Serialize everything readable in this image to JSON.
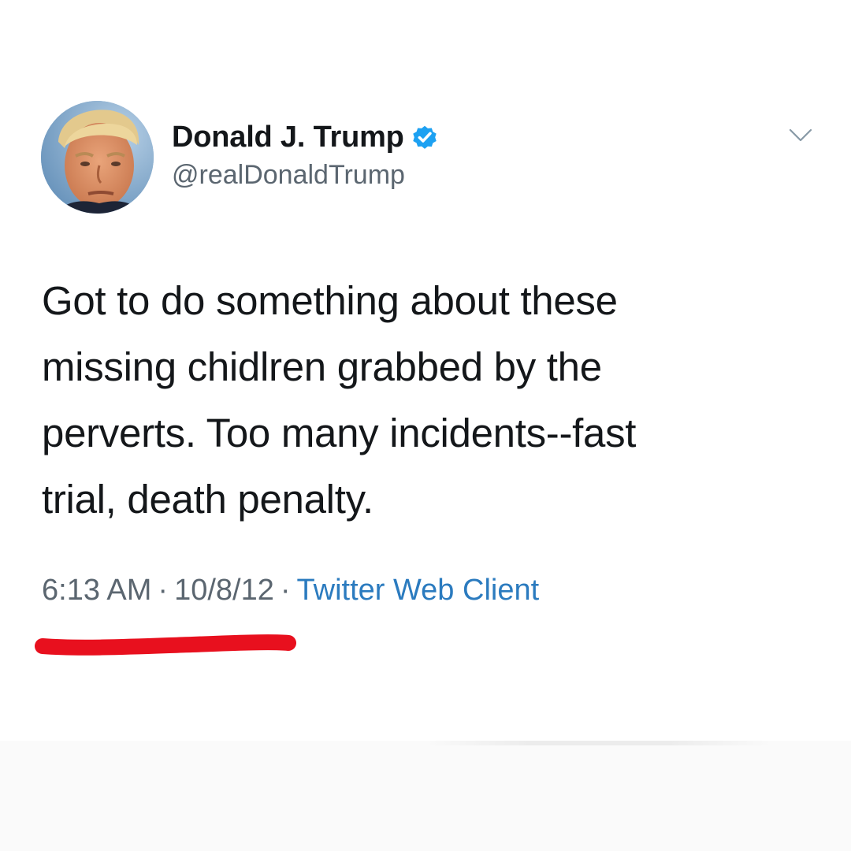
{
  "tweet": {
    "display_name": "Donald J. Trump",
    "handle": "@realDonaldTrump",
    "verified": true,
    "text_lines": [
      "Got to do something about these",
      "missing chidlren grabbed by the",
      "perverts. Too many incidents--fast",
      "trial, death penalty."
    ],
    "time": "6:13 AM",
    "separator": "·",
    "date": "10/8/12",
    "source": "Twitter Web Client"
  },
  "icons": {
    "verified": "verified-badge-icon",
    "menu": "chevron-down-icon"
  },
  "colors": {
    "verified_blue": "#1da1f2",
    "link_blue": "#2b7bbf",
    "meta_gray": "#5b6670",
    "underline_red": "#e8101e"
  }
}
